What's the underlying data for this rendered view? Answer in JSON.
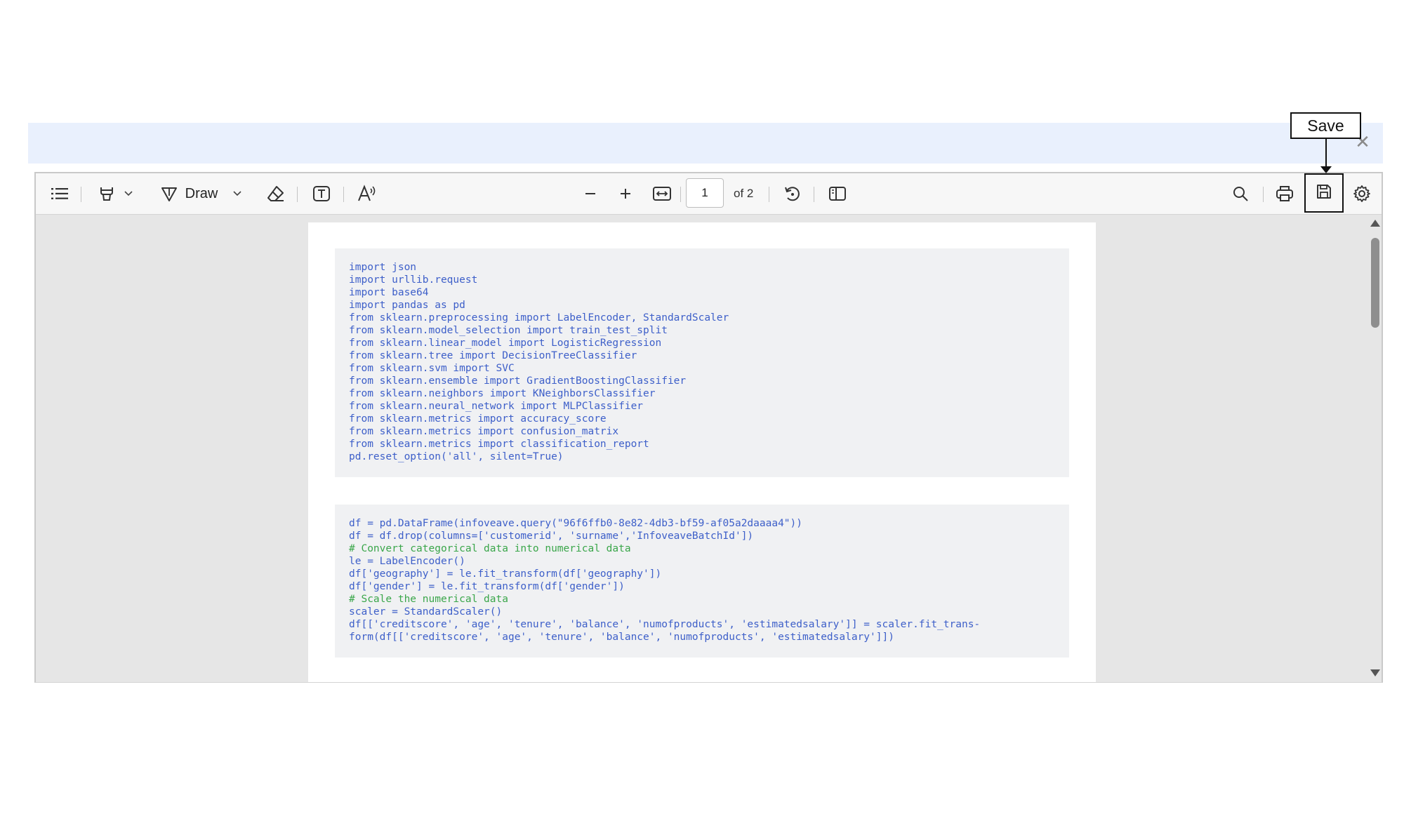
{
  "banner": {
    "close_icon": "close-icon"
  },
  "toolbar": {
    "draw_label": "Draw",
    "page_current": "1",
    "page_total": "of 2",
    "icons": [
      "list-icon",
      "highlighter-icon",
      "chevron-down-icon",
      "draw-icon",
      "chevron-down-icon",
      "eraser-icon",
      "text-box-icon",
      "read-aloud-icon",
      "zoom-out-icon",
      "zoom-in-icon",
      "fit-width-icon",
      "rotate-icon",
      "page-view-icon",
      "search-icon",
      "print-icon",
      "save-icon",
      "settings-icon"
    ]
  },
  "callout": {
    "label": "Save"
  },
  "document": {
    "code_block_1": [
      "import json",
      "import urllib.request",
      "import base64",
      "import pandas as pd",
      "from sklearn.preprocessing import LabelEncoder, StandardScaler",
      "from sklearn.model_selection import train_test_split",
      "from sklearn.linear_model import LogisticRegression",
      "from sklearn.tree import DecisionTreeClassifier",
      "from sklearn.svm import SVC",
      "from sklearn.ensemble import GradientBoostingClassifier",
      "from sklearn.neighbors import KNeighborsClassifier",
      "from sklearn.neural_network import MLPClassifier",
      "from sklearn.metrics import accuracy_score",
      "from sklearn.metrics import confusion_matrix",
      "from sklearn.metrics import classification_report",
      "pd.reset_option('all', silent=True)"
    ],
    "code_block_2": [
      "df = pd.DataFrame(infoveave.query(\"96f6ffb0-8e82-4db3-bf59-af05a2daaaa4\"))",
      "df = df.drop(columns=['customerid', 'surname','InfoveaveBatchId'])",
      "# Convert categorical data into numerical data",
      "le = LabelEncoder()",
      "df['geography'] = le.fit_transform(df['geography'])",
      "df['gender'] = le.fit_transform(df['gender'])",
      "# Scale the numerical data",
      "scaler = StandardScaler()",
      "df[['creditscore', 'age', 'tenure', 'balance', 'numofproducts', 'estimatedsalary']] = scaler.fit_trans-",
      "form(df[['creditscore', 'age', 'tenure', 'balance', 'numofproducts', 'estimatedsalary']])"
    ]
  },
  "colors": {
    "code_text": "#3d5fc9",
    "code_comment": "#3aa64a",
    "banner_bg": "#e9f0fd"
  }
}
